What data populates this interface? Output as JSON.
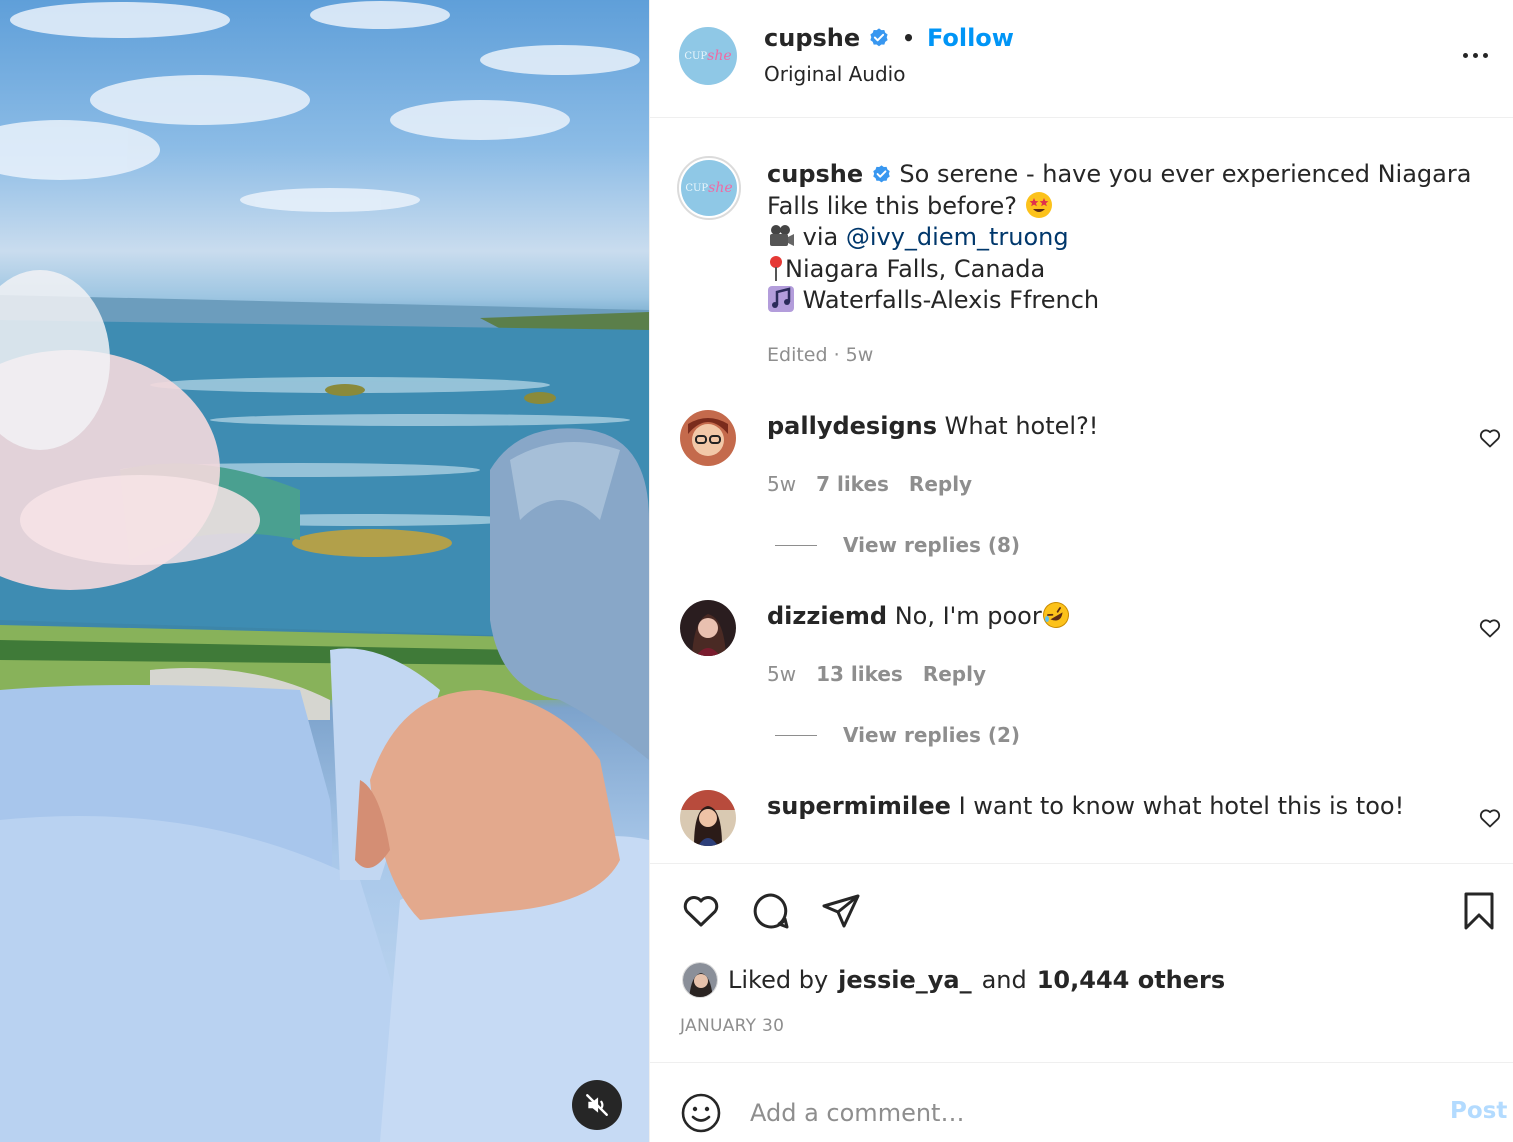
{
  "header": {
    "username": "cupshe",
    "separator": "•",
    "follow_label": "Follow",
    "subtitle": "Original Audio",
    "avatar_logo": {
      "cup": "CUP",
      "she": "she"
    }
  },
  "caption": {
    "username": "cupshe",
    "line1": "So serene - have you ever experienced Niagara Falls like this before?",
    "line2_prefix": "via",
    "mention": "@ivy_diem_truong",
    "line3": "Niagara Falls, Canada",
    "line4": "Waterfalls-Alexis Ffrench",
    "meta": "Edited · 5w"
  },
  "comments": [
    {
      "username": "pallydesigns",
      "text": "What hotel?!",
      "time": "5w",
      "likes": "7 likes",
      "reply_label": "Reply",
      "view_replies": "View replies (8)"
    },
    {
      "username": "dizziemd",
      "text": "No, I'm poor",
      "time": "5w",
      "likes": "13 likes",
      "reply_label": "Reply",
      "view_replies": "View replies (2)"
    },
    {
      "username": "supermimilee",
      "text": "I want to know what hotel this is too!"
    }
  ],
  "likes": {
    "prefix": "Liked by",
    "user": "jessie_ya_",
    "and": "and",
    "others": "10,444 others"
  },
  "date": "JANUARY 30",
  "add_comment": {
    "placeholder": "Add a comment…",
    "post_label": "Post"
  },
  "icons": {
    "verified": "verified-badge-icon",
    "more": "more-options-icon",
    "heart": "heart-icon",
    "comment": "comment-icon",
    "share": "share-icon",
    "save": "bookmark-icon",
    "smile": "emoji-icon",
    "mute": "muted-speaker-icon"
  },
  "colors": {
    "accent": "#0095f6",
    "mention": "#00376b",
    "muted_text": "#8e8e8e",
    "post_disabled": "#b3dbff",
    "verified": "#3897f0"
  }
}
